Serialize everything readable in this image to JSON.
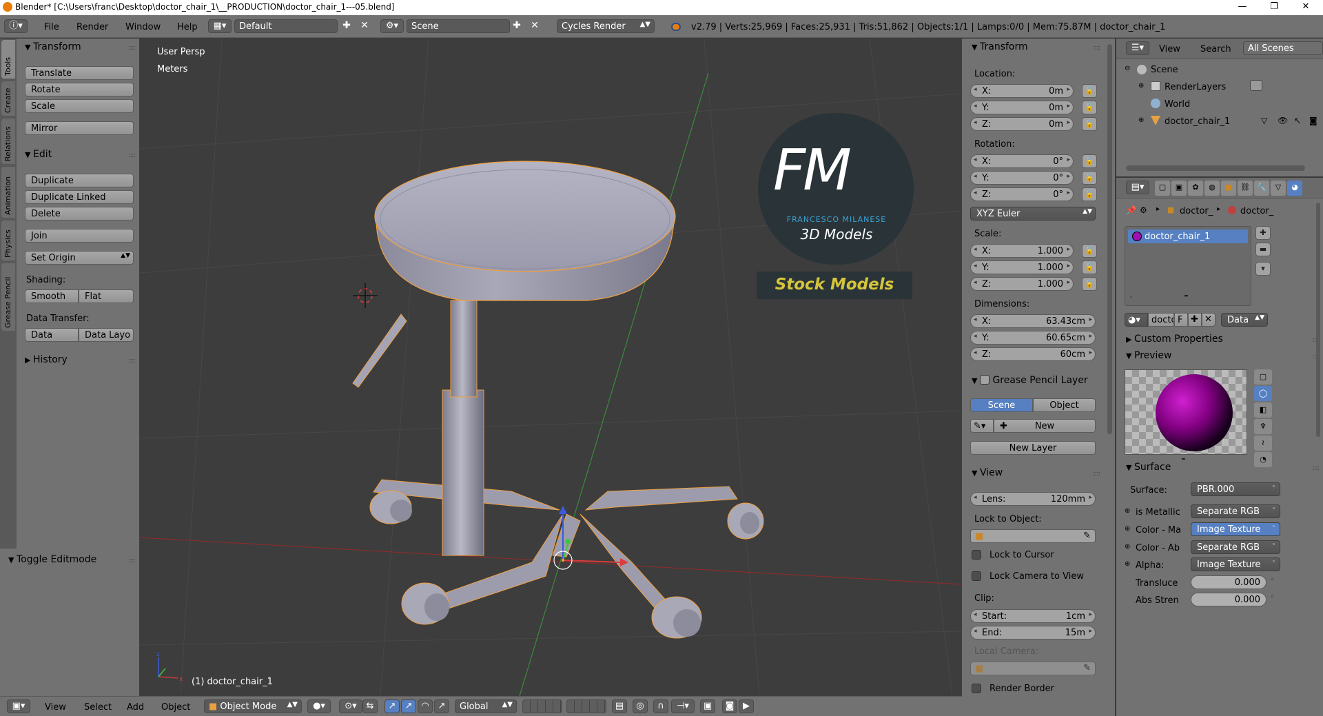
{
  "titlebar": {
    "title": "Blender* [C:\\Users\\franc\\Desktop\\doctor_chair_1\\__PRODUCTION\\doctor_chair_1---05.blend]",
    "minimize": "—",
    "restore": "❐",
    "close": "✕"
  },
  "header": {
    "menus": [
      "File",
      "Render",
      "Window",
      "Help"
    ],
    "layout": "Default",
    "scene": "Scene",
    "engine": "Cycles Render",
    "stats": "v2.79 | Verts:25,969 | Faces:25,931 | Tris:51,862 | Objects:1/1 | Lamps:0/0 | Mem:75.87M | doctor_chair_1"
  },
  "lefttabs": [
    "Tools",
    "Create",
    "Relations",
    "Animation",
    "Physics",
    "Grease Pencil"
  ],
  "toolshelf": {
    "transform_title": "Transform",
    "translate": "Translate",
    "rotate": "Rotate",
    "scale": "Scale",
    "mirror": "Mirror",
    "edit_title": "Edit",
    "duplicate": "Duplicate",
    "duplicate_linked": "Duplicate Linked",
    "delete": "Delete",
    "join": "Join",
    "set_origin": "Set Origin",
    "shading_label": "Shading:",
    "smooth": "Smooth",
    "flat": "Flat",
    "data_transfer_label": "Data Transfer:",
    "data": "Data",
    "data_layout": "Data Layo",
    "history_title": "History",
    "toggle_editmode": "Toggle Editmode"
  },
  "viewport": {
    "view_name": "User Persp",
    "units": "Meters",
    "object_label": "(1) doctor_chair_1",
    "watermark": {
      "logo": "FM",
      "line1": "FRANCESCO MILANESE",
      "line2": "3D Models",
      "banner": "Stock Models"
    }
  },
  "npanel": {
    "transform_title": "Transform",
    "location_label": "Location:",
    "location": {
      "x": "0m",
      "y": "0m",
      "z": "0m"
    },
    "rotation_label": "Rotation:",
    "rotation": {
      "x": "0°",
      "y": "0°",
      "z": "0°"
    },
    "rotation_mode": "XYZ Euler",
    "scale_label": "Scale:",
    "scale": {
      "x": "1.000",
      "y": "1.000",
      "z": "1.000"
    },
    "dimensions_label": "Dimensions:",
    "dimensions": {
      "x": "63.43cm",
      "y": "60.65cm",
      "z": "60cm"
    },
    "axis": {
      "x": "X:",
      "y": "Y:",
      "z": "Z:"
    },
    "grease_title": "Grease Pencil Layer",
    "grease_scene": "Scene",
    "grease_object": "Object",
    "grease_new": "New",
    "grease_new_layer": "New Layer",
    "view_title": "View",
    "lens_label": "Lens:",
    "lens": "120mm",
    "lock_object_label": "Lock to Object:",
    "lock_cursor": "Lock to Cursor",
    "lock_camera": "Lock Camera to View",
    "clip_label": "Clip:",
    "clip_start_label": "Start:",
    "clip_start": "1cm",
    "clip_end_label": "End:",
    "clip_end": "15m",
    "local_camera": "Local Camera:",
    "render_border": "Render Border"
  },
  "outliner": {
    "view": "View",
    "search": "Search",
    "filter": "All Scenes",
    "items": [
      "Scene",
      "RenderLayers",
      "World",
      "doctor_chair_1"
    ]
  },
  "properties": {
    "crumb1": "doctor_",
    "crumb2": "doctor_",
    "material_slot": "doctor_chair_1",
    "mat_name": "docto",
    "mat_fake": "F",
    "mat_link": "Data",
    "custom_props": "Custom Properties",
    "preview_title": "Preview",
    "surface_title": "Surface",
    "surface_label": "Surface:",
    "surface_value": "PBR.000",
    "inputs": [
      {
        "label": "is Metallic",
        "value": "Separate RGB"
      },
      {
        "label": "Color - Ma",
        "value": "Image Texture"
      },
      {
        "label": "Color - Ab",
        "value": "Separate RGB"
      },
      {
        "label": "Alpha:",
        "value": "Image Texture"
      }
    ],
    "translucent_label": "Transluce",
    "translucent_value": "0.000",
    "abs_label": "Abs Stren",
    "abs_value": "0.000"
  },
  "bottombar": {
    "view": "View",
    "select": "Select",
    "add": "Add",
    "object": "Object",
    "mode": "Object Mode",
    "orientation": "Global"
  },
  "colors": {
    "accent": "#5680c2",
    "selected_outline": "#f0a040",
    "panel": "#727272",
    "viewport": "#3d3d3d"
  }
}
